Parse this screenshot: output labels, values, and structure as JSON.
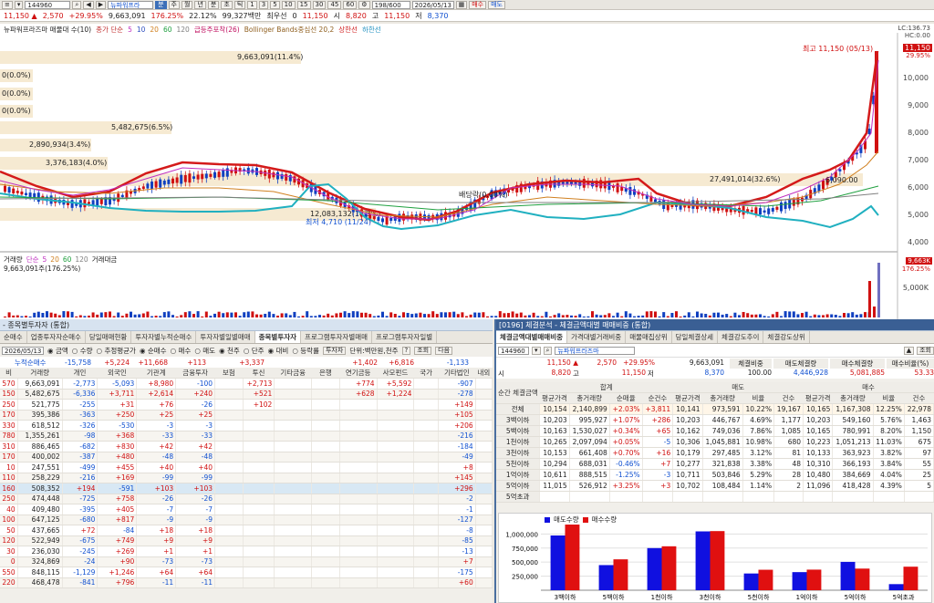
{
  "toolbar": {
    "code": "144960",
    "stock_name": "뉴파워프라",
    "period_buttons": [
      "분",
      "주",
      "월",
      "년",
      "분",
      "초",
      "틱"
    ],
    "minute_buttons": [
      "1",
      "3",
      "5",
      "10",
      "15",
      "30",
      "45",
      "60"
    ],
    "page": "198/600",
    "date": "2026/05/13",
    "buy": "매수",
    "sell": "매도"
  },
  "info": {
    "price": "11,150",
    "change": "2,570",
    "change_pct": "+29.95%",
    "volume": "9,663,091",
    "vol_ratio": "176.25%",
    "turnover": "22.12%",
    "amount": "99,327백만",
    "label_low": "최우선",
    "zero": "0",
    "bid": "11,150",
    "open_label": "시",
    "open": "8,820",
    "high_label": "고",
    "high": "11,150",
    "low_label": "저",
    "low": "8,370"
  },
  "chart": {
    "legend": {
      "name": "뉴파워프라즈마 매물대 수(10)",
      "ma_label": "종가 단순",
      "ma_5": "5",
      "ma_10": "10",
      "ma_20": "20",
      "ma_60": "60",
      "ma_120": "120",
      "extra": "급등주포착(26)",
      "bb": "Bollinger Bands중심선 20,2",
      "upper": "상한선",
      "lower": "하한선"
    },
    "corner_lc": "LC:136.73",
    "corner_hc": "HC:0.00",
    "volume_bars_labels": [
      "9,663,091(11.4%)",
      "0(0.0%)",
      "0(0.0%)",
      "0(0.0%)",
      "5,482,675(6.5%)",
      "2,890,934(3.4%)",
      "3,376,183(4.0%)",
      "27,491,014(32.6%)",
      "12,083,132(14.3%)"
    ],
    "y_labels": [
      "10,000",
      "9,000",
      "8,000",
      "7,000",
      "6,000",
      "5,000",
      "4,000"
    ],
    "price_tag": "11,150",
    "price_tag_pct": "29.95%",
    "high_note": "최고 11,150 (05/13)",
    "low_note": "최저 4,710 (11/24)",
    "mid_note_1": "배당락(0.00%)",
    "mid_note_2": "6,090.00",
    "vol_legend": {
      "label": "거래량",
      "simple": "단순",
      "p5": "5",
      "p20": "20",
      "p60": "60",
      "p120": "120",
      "amount": "거래대금"
    },
    "vol_value": "9,663,091주(176.25%)",
    "vol_tag": "9,663K",
    "vol_tag_pct": "176.25%",
    "vol_y": "5,000K"
  },
  "left_panel": {
    "title": "- 종목별투자자 (통합)",
    "tabs": [
      "순매수",
      "업종투자자순매수",
      "당일매매현황",
      "투자자별누적순매수",
      "투자자별일별매매",
      "종목별투자자",
      "프로그램투자자별매매",
      "프로그램투자자일별"
    ],
    "date": "2026/05/13",
    "radio": [
      "금액",
      "수량",
      "추정평균가",
      "순매수",
      "매수",
      "매도",
      "천주",
      "단주",
      "대비",
      "등락률",
      "투자자"
    ],
    "unit": "단위:백만원,천주",
    "search": "조회",
    "next": "다음",
    "sum_label": "누적순매수",
    "sums": [
      "-15,758",
      "+5,224",
      "+11,668",
      "+113",
      "",
      "+3,337",
      "",
      "",
      "+1,402",
      "+6,816",
      "",
      "-1,133"
    ],
    "headers": [
      "비",
      "거래량",
      "개인",
      "외국인",
      "기관계",
      "금융투자",
      "보험",
      "투신",
      "기타금융",
      "은행",
      "연기금등",
      "사모펀드",
      "국가",
      "기타법인",
      "내외"
    ],
    "rows": [
      [
        "570",
        "9,663,091",
        "-2,773",
        "-5,093",
        "+8,980",
        "-100",
        "",
        "+2,713",
        "",
        "",
        "+774",
        "+5,592",
        "",
        "-907"
      ],
      [
        "150",
        "5,482,675",
        "-6,336",
        "+3,711",
        "+2,614",
        "+240",
        "",
        "+521",
        "",
        "",
        "+628",
        "+1,224",
        "",
        "-278"
      ],
      [
        "250",
        "521,775",
        "-255",
        "+31",
        "+76",
        "-26",
        "",
        "+102",
        "",
        "",
        "",
        "",
        "",
        "+149"
      ],
      [
        "170",
        "395,386",
        "-363",
        "+250",
        "+25",
        "+25",
        "",
        "",
        "",
        "",
        "",
        "",
        "",
        "+105"
      ],
      [
        "330",
        "618,512",
        "-326",
        "-530",
        "-3",
        "-3",
        "",
        "",
        "",
        "",
        "",
        "",
        "",
        "+206"
      ],
      [
        "780",
        "1,355,261",
        "-98",
        "+368",
        "-33",
        "-33",
        "",
        "",
        "",
        "",
        "",
        "",
        "",
        "-216"
      ],
      [
        "310",
        "886,465",
        "-682",
        "+830",
        "+42",
        "+42",
        "",
        "",
        "",
        "",
        "",
        "",
        "",
        "-184"
      ],
      [
        "170",
        "400,002",
        "-387",
        "+480",
        "-48",
        "-48",
        "",
        "",
        "",
        "",
        "",
        "",
        "",
        "-49"
      ],
      [
        "10",
        "247,551",
        "-499",
        "+455",
        "+40",
        "+40",
        "",
        "",
        "",
        "",
        "",
        "",
        "",
        "+8"
      ],
      [
        "110",
        "258,229",
        "-216",
        "+169",
        "-99",
        "-99",
        "",
        "",
        "",
        "",
        "",
        "",
        "",
        "+145"
      ],
      [
        "160",
        "508,352",
        "+194",
        "-591",
        "+103",
        "+103",
        "",
        "",
        "",
        "",
        "",
        "",
        "",
        "+296"
      ],
      [
        "250",
        "474,448",
        "-725",
        "+758",
        "-26",
        "-26",
        "",
        "",
        "",
        "",
        "",
        "",
        "",
        "-2"
      ],
      [
        "40",
        "409,480",
        "-395",
        "+405",
        "-7",
        "-7",
        "",
        "",
        "",
        "",
        "",
        "",
        "",
        "-1"
      ],
      [
        "100",
        "647,125",
        "-680",
        "+817",
        "-9",
        "-9",
        "",
        "",
        "",
        "",
        "",
        "",
        "",
        "-127"
      ],
      [
        "50",
        "437,665",
        "+72",
        "-84",
        "+18",
        "+18",
        "",
        "",
        "",
        "",
        "",
        "",
        "",
        "-8"
      ],
      [
        "120",
        "522,949",
        "-675",
        "+749",
        "+9",
        "+9",
        "",
        "",
        "",
        "",
        "",
        "",
        "",
        "-85"
      ],
      [
        "30",
        "236,030",
        "-245",
        "+269",
        "+1",
        "+1",
        "",
        "",
        "",
        "",
        "",
        "",
        "",
        "-13"
      ],
      [
        "0",
        "324,869",
        "-24",
        "+90",
        "-73",
        "-73",
        "",
        "",
        "",
        "",
        "",
        "",
        "",
        "+7"
      ],
      [
        "550",
        "848,115",
        "-1,129",
        "+1,246",
        "+64",
        "+64",
        "",
        "",
        "",
        "",
        "",
        "",
        "",
        "-175"
      ],
      [
        "220",
        "468,478",
        "-841",
        "+796",
        "-11",
        "-11",
        "",
        "",
        "",
        "",
        "",
        "",
        "",
        "+60"
      ]
    ]
  },
  "right_panel": {
    "title": "[0196] 체결분석 - 체결금액대별 매매비중 (통합)",
    "tabs": [
      "체결금액대별매매비중",
      "가격대별거래비중",
      "매물매집상위",
      "당일체결상세",
      "체결강도추이",
      "체결강도상위"
    ],
    "code": "144960",
    "name": "뉴파워프라즈마",
    "search": "조회",
    "price": "11,150",
    "change": "2,570",
    "change_pct": "+29.95%",
    "volume": "9,663,091",
    "open_label": "시",
    "open": "8,820",
    "high_label": "고",
    "high": "11,150",
    "low_label": "저",
    "low": "8,370",
    "stats_headers": [
      "체결비중",
      "매도체결량",
      "매수체결량",
      "매수비율(%)"
    ],
    "stats_values": [
      "100.00",
      "4,446,928",
      "5,081,885",
      "53.33"
    ],
    "group_headers": [
      "순간\n체결금액",
      "합계",
      "매도",
      "매수"
    ],
    "headers": [
      "평균가격",
      "총거래량",
      "순매율",
      "순건수",
      "평균가격",
      "총거래량",
      "비율",
      "건수",
      "평균가격",
      "총거래량",
      "비율",
      "건수"
    ],
    "rows": [
      [
        "전체",
        "10,154",
        "2,140,899",
        "+2.03%",
        "+3,811",
        "10,141",
        "973,591",
        "10.22%",
        "19,167",
        "10,165",
        "1,167,308",
        "12.25%",
        "22,978"
      ],
      [
        "3백이하",
        "10,203",
        "995,927",
        "+1.07%",
        "+286",
        "10,203",
        "446,767",
        "4.69%",
        "1,177",
        "10,203",
        "549,160",
        "5.76%",
        "1,463"
      ],
      [
        "5백이하",
        "10,163",
        "1,530,027",
        "+0.34%",
        "+65",
        "10,162",
        "749,036",
        "7.86%",
        "1,085",
        "10,165",
        "780,991",
        "8.20%",
        "1,150"
      ],
      [
        "1천이하",
        "10,265",
        "2,097,094",
        "+0.05%",
        "-5",
        "10,306",
        "1,045,881",
        "10.98%",
        "680",
        "10,223",
        "1,051,213",
        "11.03%",
        "675"
      ],
      [
        "3천이하",
        "10,153",
        "661,408",
        "+0.70%",
        "+16",
        "10,179",
        "297,485",
        "3.12%",
        "81",
        "10,133",
        "363,923",
        "3.82%",
        "97"
      ],
      [
        "5천이하",
        "10,294",
        "688,031",
        "-0.46%",
        "+7",
        "10,277",
        "321,838",
        "3.38%",
        "48",
        "10,310",
        "366,193",
        "3.84%",
        "55"
      ],
      [
        "1억이하",
        "10,611",
        "888,515",
        "-1.25%",
        "-3",
        "10,711",
        "503,846",
        "5.29%",
        "28",
        "10,480",
        "384,669",
        "4.04%",
        "25"
      ],
      [
        "5억이하",
        "11,015",
        "526,912",
        "+3.25%",
        "+3",
        "10,702",
        "108,484",
        "1.14%",
        "2",
        "11,096",
        "418,428",
        "4.39%",
        "5"
      ],
      [
        "5억초과",
        "",
        "",
        "",
        "",
        "",
        "",
        "",
        "",
        "",
        "",
        "",
        ""
      ]
    ],
    "bar_legend_sell": "매도수량",
    "bar_legend_buy": "매수수량",
    "bar_y": [
      "1,000,000",
      "750,000",
      "500,000",
      "250,000"
    ],
    "chart_data": {
      "type": "bar",
      "categories": [
        "3백이하",
        "5백이하",
        "1천이하",
        "3천이하",
        "5천이하",
        "1억이하",
        "5억이하",
        "5억초과"
      ],
      "series": [
        {
          "name": "매도수량",
          "values": [
            973591,
            446767,
            749036,
            1045881,
            297485,
            321838,
            503846,
            108484
          ]
        },
        {
          "name": "매수수량",
          "values": [
            1167308,
            549160,
            780991,
            1051213,
            363923,
            366193,
            384669,
            418428
          ]
        }
      ],
      "ylim": [
        0,
        1200000
      ]
    }
  }
}
